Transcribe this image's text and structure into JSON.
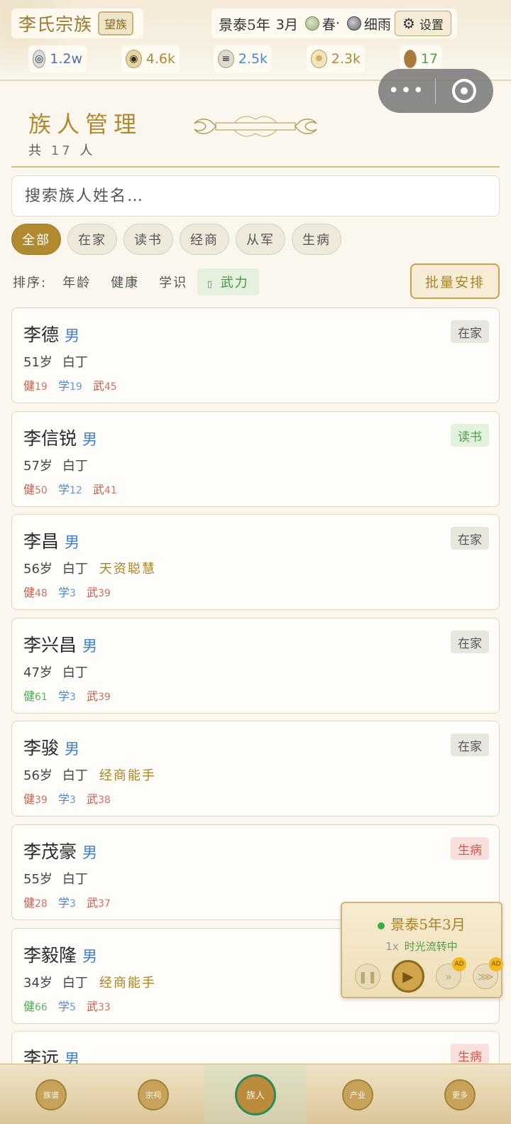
{
  "header": {
    "clan_name": "李氏宗族",
    "clan_rank": "望族",
    "era": "景泰",
    "year": "5",
    "year_unit": "年",
    "month": "3月",
    "season": "春",
    "weather": "细雨",
    "settings_label": "设置",
    "resources": [
      {
        "icon": "silver-icon",
        "value": "1.2w",
        "color": "#4a6fa8"
      },
      {
        "icon": "money-bag-icon",
        "value": "4.6k",
        "color": "#b08a33"
      },
      {
        "icon": "grain-icon",
        "value": "2.5k",
        "color": "#4a86c8"
      },
      {
        "icon": "prestige-icon",
        "value": "2.3k",
        "color": "#b08a33"
      },
      {
        "icon": "population-icon",
        "value": "17",
        "color": "#4aa24a"
      }
    ]
  },
  "title_section": {
    "title": "族人管理",
    "count_prefix": "共",
    "count": "17",
    "count_suffix": "人"
  },
  "search": {
    "placeholder": "搜索族人姓名…"
  },
  "filters": [
    "全部",
    "在家",
    "读书",
    "经商",
    "从军",
    "生病"
  ],
  "sort": {
    "label": "排序:",
    "options": [
      "年龄",
      "健康",
      "学识",
      "武力"
    ],
    "active_icon": "▯"
  },
  "batch_label": "批量安排",
  "members": [
    {
      "name": "李德",
      "gender": "男",
      "age": "51",
      "age_unit": "岁",
      "title": "白丁",
      "trait": "",
      "jian_label": "健",
      "jian": "19",
      "xue_label": "学",
      "xue": "19",
      "wu_label": "武",
      "wu": "45",
      "status": "在家"
    },
    {
      "name": "李信锐",
      "gender": "男",
      "age": "57",
      "age_unit": "岁",
      "title": "白丁",
      "trait": "",
      "jian_label": "健",
      "jian": "50",
      "xue_label": "学",
      "xue": "12",
      "wu_label": "武",
      "wu": "41",
      "status": "读书"
    },
    {
      "name": "李昌",
      "gender": "男",
      "age": "56",
      "age_unit": "岁",
      "title": "白丁",
      "trait": "天资聪慧",
      "jian_label": "健",
      "jian": "48",
      "xue_label": "学",
      "xue": "3",
      "wu_label": "武",
      "wu": "39",
      "status": "在家"
    },
    {
      "name": "李兴昌",
      "gender": "男",
      "age": "47",
      "age_unit": "岁",
      "title": "白丁",
      "trait": "",
      "jian_label": "健",
      "jian": "61",
      "xue_label": "学",
      "xue": "3",
      "wu_label": "武",
      "wu": "39",
      "status": "在家"
    },
    {
      "name": "李骏",
      "gender": "男",
      "age": "56",
      "age_unit": "岁",
      "title": "白丁",
      "trait": "经商能手",
      "jian_label": "健",
      "jian": "39",
      "xue_label": "学",
      "xue": "3",
      "wu_label": "武",
      "wu": "38",
      "status": "在家"
    },
    {
      "name": "李茂豪",
      "gender": "男",
      "age": "55",
      "age_unit": "岁",
      "title": "白丁",
      "trait": "",
      "jian_label": "健",
      "jian": "28",
      "xue_label": "学",
      "xue": "3",
      "wu_label": "武",
      "wu": "37",
      "status": "生病"
    },
    {
      "name": "李毅隆",
      "gender": "男",
      "age": "34",
      "age_unit": "岁",
      "title": "白丁",
      "trait": "经商能手",
      "jian_label": "健",
      "jian": "66",
      "xue_label": "学",
      "xue": "5",
      "wu_label": "武",
      "wu": "33",
      "status": ""
    },
    {
      "name": "李远",
      "gender": "男",
      "age": "",
      "age_unit": "",
      "title": "",
      "trait": "",
      "jian_label": "",
      "jian": "",
      "xue_label": "",
      "xue": "",
      "wu_label": "",
      "wu": "",
      "status": "生病"
    }
  ],
  "time_panel": {
    "date": "景泰5年3月",
    "speed": "1x",
    "status": "时光流转中",
    "ad_label": "AD"
  },
  "bottom_nav": [
    {
      "label": "族谱",
      "icon": "book-icon"
    },
    {
      "label": "宗祠",
      "icon": "temple-icon"
    },
    {
      "label": "族人",
      "icon": "people-icon"
    },
    {
      "label": "产业",
      "icon": "scroll-icon"
    },
    {
      "label": "更多",
      "icon": "more-icon"
    }
  ]
}
